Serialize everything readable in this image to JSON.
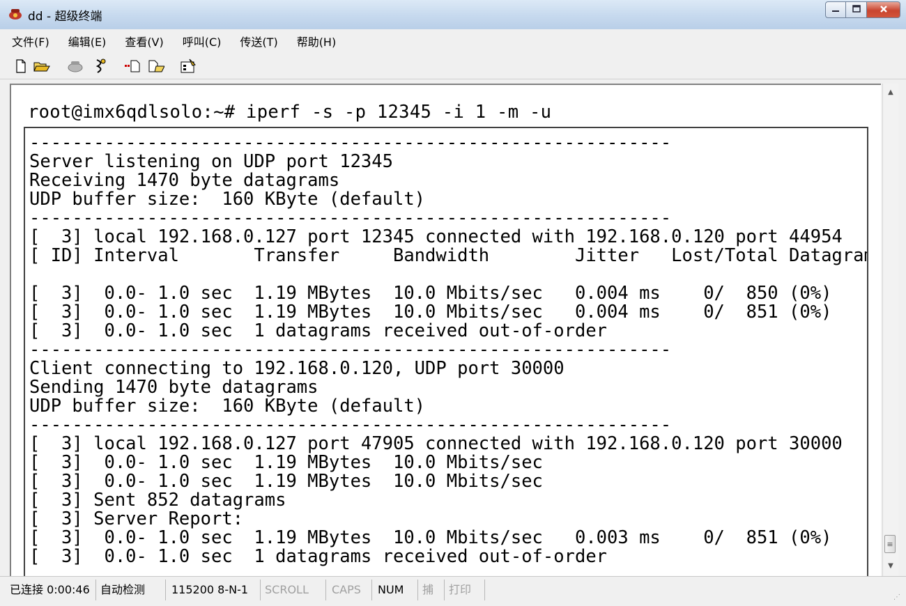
{
  "window": {
    "title": "dd - 超级终端",
    "app_icon": "hyperterminal-phone-icon"
  },
  "menu": [
    {
      "label": "文件(F)"
    },
    {
      "label": "编辑(E)"
    },
    {
      "label": "查看(V)"
    },
    {
      "label": "呼叫(C)"
    },
    {
      "label": "传送(T)"
    },
    {
      "label": "帮助(H)"
    }
  ],
  "toolbar_icons": [
    "new-document-icon",
    "open-folder-icon",
    "call-icon",
    "disconnect-icon",
    "send-icon",
    "receive-icon",
    "properties-icon"
  ],
  "terminal": {
    "command": "root@imx6qdlsolo:~# iperf -s -p 12345 -i 1 -m -u",
    "lines": [
      "------------------------------------------------------------",
      "Server listening on UDP port 12345",
      "Receiving 1470 byte datagrams",
      "UDP buffer size:  160 KByte (default)",
      "------------------------------------------------------------",
      "[  3] local 192.168.0.127 port 12345 connected with 192.168.0.120 port 44954",
      "[ ID] Interval       Transfer     Bandwidth        Jitter   Lost/Total Datagrams",
      "",
      "[  3]  0.0- 1.0 sec  1.19 MBytes  10.0 Mbits/sec   0.004 ms    0/  850 (0%)",
      "[  3]  0.0- 1.0 sec  1.19 MBytes  10.0 Mbits/sec   0.004 ms    0/  851 (0%)",
      "[  3]  0.0- 1.0 sec  1 datagrams received out-of-order",
      "------------------------------------------------------------",
      "Client connecting to 192.168.0.120, UDP port 30000",
      "Sending 1470 byte datagrams",
      "UDP buffer size:  160 KByte (default)",
      "------------------------------------------------------------",
      "[  3] local 192.168.0.127 port 47905 connected with 192.168.0.120 port 30000",
      "[  3]  0.0- 1.0 sec  1.19 MBytes  10.0 Mbits/sec",
      "[  3]  0.0- 1.0 sec  1.19 MBytes  10.0 Mbits/sec",
      "[  3] Sent 852 datagrams",
      "[  3] Server Report:",
      "[  3]  0.0- 1.0 sec  1.19 MBytes  10.0 Mbits/sec   0.003 ms    0/  851 (0%)",
      "[  3]  0.0- 1.0 sec  1 datagrams received out-of-order"
    ]
  },
  "statusbar": {
    "connected": "已连接 0:00:46",
    "detect": "自动检测",
    "port_settings": "115200 8-N-1",
    "scroll": "SCROLL",
    "caps": "CAPS",
    "num": "NUM",
    "capture": "捕",
    "print": "打印"
  }
}
